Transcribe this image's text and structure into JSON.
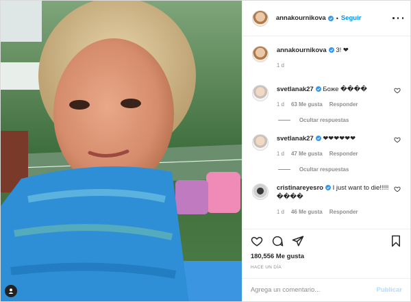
{
  "header": {
    "username": "annakournikova",
    "separator": "•",
    "follow_label": "Seguir"
  },
  "caption": {
    "username": "annakournikova",
    "text": "3! ❤",
    "time": "1 d"
  },
  "comments": [
    {
      "username": "svetlanak27",
      "verified": true,
      "text": "Боже ���� ",
      "time": "1 d",
      "likes": "63 Me gusta",
      "reply": "Responder"
    },
    {
      "username": "svetlanak27",
      "verified": true,
      "text": "❤❤❤❤❤❤",
      "time": "1 d",
      "likes": "47 Me gusta",
      "reply": "Responder"
    },
    {
      "username": "cristinareyesro",
      "verified": true,
      "text": "I just want to die!!!!! ����",
      "time": "1 d",
      "likes": "46 Me gusta",
      "reply": "Responder"
    }
  ],
  "thread_labels": [
    "Ocultar respuestas",
    "Ocultar respuestas"
  ],
  "actions": {
    "likes_count": "180,556 Me gusta",
    "time_ago": "HACE UN DÍA"
  },
  "add_comment": {
    "placeholder": "Agrega un comentario...",
    "publish": "Publicar"
  },
  "colors": {
    "accent": "#0095f6",
    "muted": "#8e8e8e",
    "publish_disabled": "#b3dbff"
  }
}
